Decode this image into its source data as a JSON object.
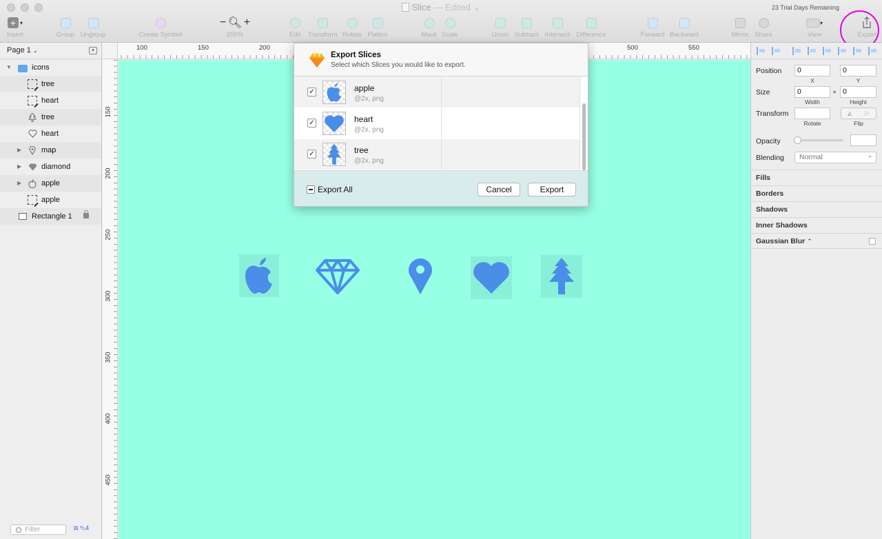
{
  "window": {
    "title": "Slice",
    "status": "Edited",
    "trial": "23 Trial Days Remaining"
  },
  "toolbar": [
    {
      "id": "insert",
      "label": "Insert"
    },
    {
      "id": "group",
      "label": "Group"
    },
    {
      "id": "ungroup",
      "label": "Ungroup"
    },
    {
      "id": "create-symbol",
      "label": "Create Symbol"
    },
    {
      "id": "zoom",
      "label": "200%"
    },
    {
      "id": "edit",
      "label": "Edit"
    },
    {
      "id": "transform",
      "label": "Transform"
    },
    {
      "id": "rotate",
      "label": "Rotate"
    },
    {
      "id": "flatten",
      "label": "Flatten"
    },
    {
      "id": "mask",
      "label": "Mask"
    },
    {
      "id": "scale",
      "label": "Scale"
    },
    {
      "id": "union",
      "label": "Union"
    },
    {
      "id": "subtract",
      "label": "Subtract"
    },
    {
      "id": "intersect",
      "label": "Intersect"
    },
    {
      "id": "difference",
      "label": "Difference"
    },
    {
      "id": "forward",
      "label": "Forward"
    },
    {
      "id": "backward",
      "label": "Backward"
    },
    {
      "id": "mirror",
      "label": "Mirror"
    },
    {
      "id": "share",
      "label": "Share"
    },
    {
      "id": "view",
      "label": "View"
    },
    {
      "id": "export",
      "label": "Export"
    }
  ],
  "zoom": {
    "minus": "−",
    "plus": "+"
  },
  "layers": {
    "page": "Page 1",
    "items": [
      {
        "label": "icons",
        "icon": "folder-icon"
      },
      {
        "label": "tree",
        "icon": "slice-icon"
      },
      {
        "label": "heart",
        "icon": "slice-icon"
      },
      {
        "label": "tree",
        "icon": "tree-icon"
      },
      {
        "label": "heart",
        "icon": "heart-icon"
      },
      {
        "label": "map",
        "icon": "map-pin-icon"
      },
      {
        "label": "diamond",
        "icon": "diamond-icon"
      },
      {
        "label": "apple",
        "icon": "apple-icon"
      },
      {
        "label": "apple",
        "icon": "slice-icon"
      },
      {
        "label": "Rectangle 1",
        "icon": "rectangle-icon"
      }
    ],
    "filter_placeholder": "Filter",
    "footer_count": "4"
  },
  "rulers": {
    "top": [
      "100",
      "150",
      "200",
      "500",
      "550"
    ],
    "left": [
      "150",
      "200",
      "250",
      "300",
      "350",
      "400",
      "450"
    ]
  },
  "dialog": {
    "title": "Export Slices",
    "subtitle": "Select which Slices you would like to export.",
    "slices": [
      {
        "name": "apple",
        "meta": "@2x, png",
        "checked": true
      },
      {
        "name": "heart",
        "meta": "@2x, png",
        "checked": true
      },
      {
        "name": "tree",
        "meta": "@2x, png",
        "checked": true
      }
    ],
    "export_all": "Export All",
    "cancel": "Cancel",
    "export": "Export"
  },
  "inspector": {
    "position": {
      "label": "Position",
      "x": "0",
      "y": "0",
      "x_label": "X",
      "y_label": "Y"
    },
    "size": {
      "label": "Size",
      "w": "0",
      "h": "0",
      "w_label": "Width",
      "h_label": "Height"
    },
    "transform": {
      "label": "Transform",
      "rotate_label": "Rotate",
      "flip_label": "Flip"
    },
    "opacity": "Opacity",
    "blending": {
      "label": "Blending",
      "value": "Normal"
    },
    "sections": [
      "Fills",
      "Borders",
      "Shadows",
      "Inner Shadows",
      "Gaussian Blur"
    ]
  },
  "colors": {
    "canvas": "#96ffe4",
    "icon": "#4a8ee8",
    "highlight": "#e400e4"
  }
}
